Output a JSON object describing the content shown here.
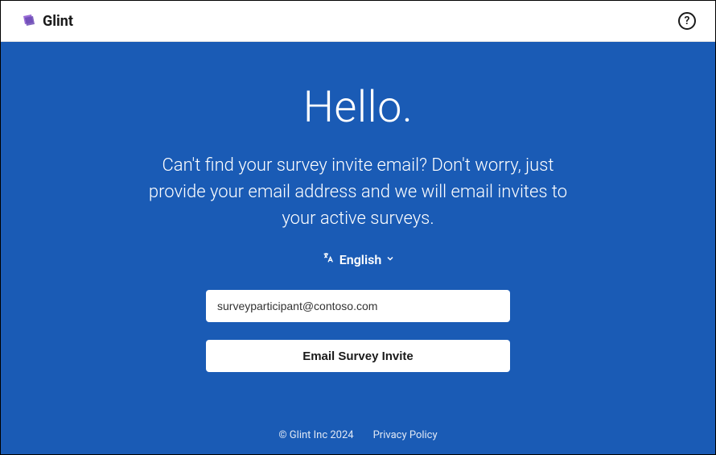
{
  "header": {
    "brand_name": "Glint",
    "help_symbol": "?"
  },
  "main": {
    "greeting": "Hello.",
    "subtitle": "Can't find your survey invite email? Don't worry, just provide your email address and we will email invites to your active surveys.",
    "language": {
      "icon": "ᵀA",
      "label": "English",
      "chevron": "⌄"
    },
    "email_value": "surveyparticipant@contoso.com",
    "submit_label": "Email Survey Invite"
  },
  "footer": {
    "copyright": "© Glint Inc 2024",
    "privacy": "Privacy Policy"
  }
}
